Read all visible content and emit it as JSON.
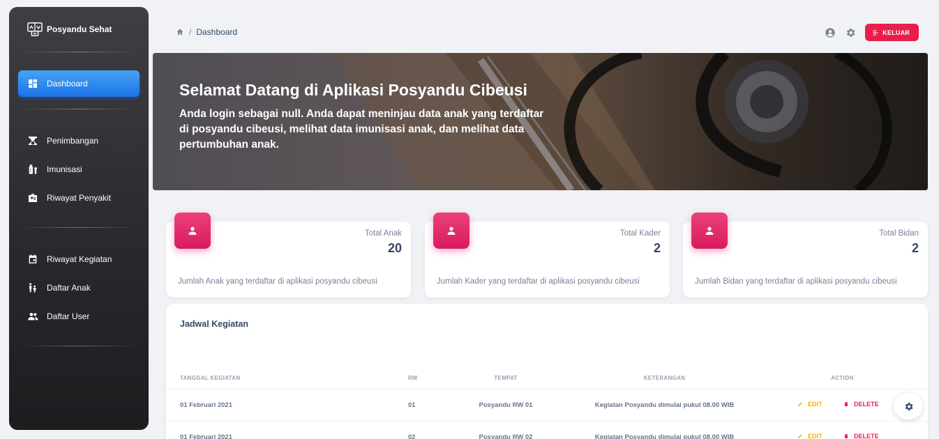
{
  "app": {
    "name": "Posyandu Sehat"
  },
  "sidebar": {
    "items": [
      {
        "label": "Dashboard",
        "icon": "dashboard-icon",
        "active": true
      },
      {
        "label": "Penimbangan",
        "icon": "scale-icon"
      },
      {
        "label": "Imunisasi",
        "icon": "vaccine-icon"
      },
      {
        "label": "Riwayat Penyakit",
        "icon": "medical-kit-icon"
      },
      {
        "label": "Riwayat Kegiatan",
        "icon": "calendar-icon"
      },
      {
        "label": "Daftar Anak",
        "icon": "family-icon"
      },
      {
        "label": "Daftar User",
        "icon": "group-icon"
      }
    ]
  },
  "header": {
    "breadcrumb": "Dashboard",
    "logout_label": "KELUAR"
  },
  "hero": {
    "title": "Selamat Datang di Aplikasi Posyandu Cibeusi",
    "subtitle": "Anda login sebagai null. Anda dapat meninjau data anak yang terdaftar di posyandu cibeusi, melihat data imunisasi anak, dan melihat data pertumbuhan anak."
  },
  "stats": [
    {
      "label": "Total Anak",
      "value": "20",
      "desc": "Jumlah Anak yang terdaftar di aplikasi posyandu cibeusi"
    },
    {
      "label": "Total Kader",
      "value": "2",
      "desc": "Jumlah Kader yang terdaftar di aplikasi posyandu cibeusi"
    },
    {
      "label": "Total Bidan",
      "value": "2",
      "desc": "Jumlah Bidan yang terdaftar di aplikasi posyandu cibeusi"
    }
  ],
  "schedule": {
    "title": "Jadwal Kegiatan",
    "columns": [
      "TANGGAL KEGIATAN",
      "RW",
      "TEMPAT",
      "KETERANGAN",
      "ACTION"
    ],
    "rows": [
      {
        "date": "01 Februari 2021",
        "rw": "01",
        "place": "Posyandu RW 01",
        "note": "Kegiatan Posyandu dimulai pukul 08.00 WIB"
      },
      {
        "date": "01 Februari 2021",
        "rw": "02",
        "place": "Posyandu RW 02",
        "note": "Kegiatan Posyandu dimulai pukul 08.00 WIB"
      }
    ],
    "edit_label": "EDIT",
    "delete_label": "DELETE"
  },
  "colors": {
    "accent": "#1a73e8",
    "danger": "#e91e4b",
    "warning": "#f4b400",
    "stat_icon": "#e91e63"
  }
}
